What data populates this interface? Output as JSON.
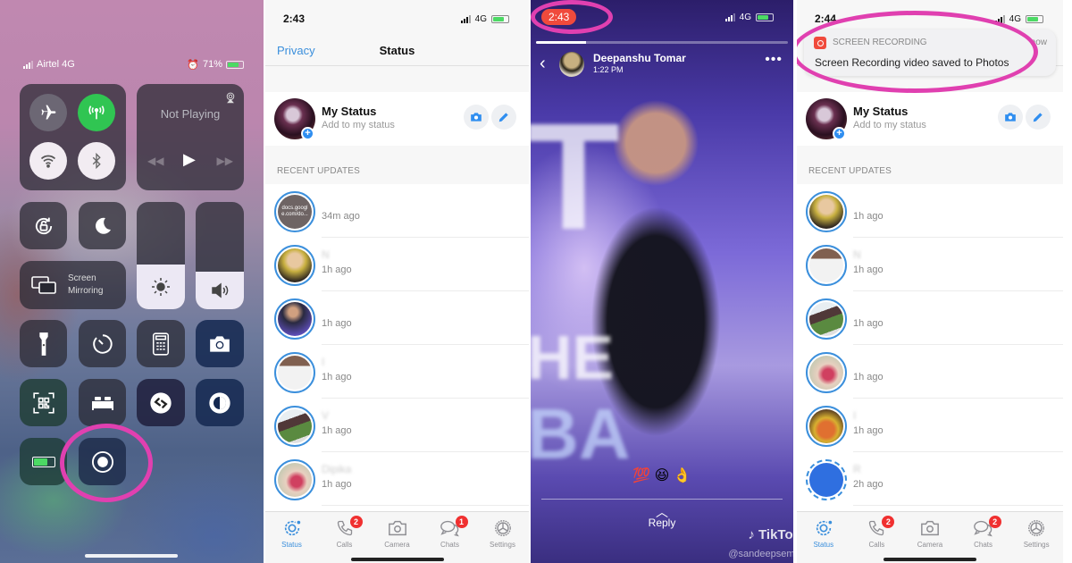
{
  "control_center": {
    "carrier": "Airtel 4G",
    "battery": "71%",
    "media": {
      "title": "Not Playing"
    },
    "screen_mirroring": {
      "line1": "Screen",
      "line2": "Mirroring"
    },
    "brightness_level": 0.42,
    "volume_level": 0.35,
    "colors": {
      "cellular_active": "#30c552",
      "highlight_ring": "#e040b0"
    }
  },
  "status_screen": {
    "time": "2:43",
    "network": "4G",
    "nav": {
      "left": "Privacy",
      "title": "Status"
    },
    "my_status": {
      "name": "My Status",
      "subtitle": "Add to my status"
    },
    "section_header": "RECENT UPDATES",
    "updates": [
      {
        "name": "",
        "thumb_text": "docs.googl e.com/do...",
        "time": "34m ago"
      },
      {
        "name": "N",
        "time": "1h ago"
      },
      {
        "name": "",
        "time": "1h ago"
      },
      {
        "name": "I",
        "time": "1h ago"
      },
      {
        "name": "V",
        "time": "1h ago"
      },
      {
        "name": "Dipika",
        "time": "1h ago"
      }
    ],
    "tabs": [
      {
        "label": "Status",
        "badge": ""
      },
      {
        "label": "Calls",
        "badge": "2"
      },
      {
        "label": "Camera",
        "badge": ""
      },
      {
        "label": "Chats",
        "badge": "1"
      },
      {
        "label": "Settings",
        "badge": ""
      }
    ],
    "accent": "#3b8fdc"
  },
  "status_viewer": {
    "recording_time": "2:43",
    "network": "4G",
    "progress": 0.2,
    "author": "Deepanshu Tomar",
    "posted": "1:22 PM",
    "caption": "💯 😆 👌",
    "reply_label": "Reply",
    "watermark": "TikTok",
    "watermark_user": "@sandeepsemi",
    "more_label": "•••",
    "back_label": "‹"
  },
  "status_screen_after": {
    "time": "2:44",
    "network": "4G",
    "notification": {
      "app": "SCREEN RECORDING",
      "when": "now",
      "message": "Screen Recording video saved to Photos"
    },
    "my_status": {
      "name": "My Status",
      "subtitle": "Add to my status"
    },
    "section_header": "RECENT UPDATES",
    "updates": [
      {
        "name": "",
        "time": "1h ago"
      },
      {
        "name": "N",
        "time": "1h ago"
      },
      {
        "name": "",
        "time": "1h ago"
      },
      {
        "name": "",
        "time": "1h ago"
      },
      {
        "name": "I",
        "time": "1h ago"
      },
      {
        "name": "R",
        "time": "2h ago"
      }
    ],
    "tabs": [
      {
        "label": "Status",
        "badge": ""
      },
      {
        "label": "Calls",
        "badge": "2"
      },
      {
        "label": "Camera",
        "badge": ""
      },
      {
        "label": "Chats",
        "badge": "2"
      },
      {
        "label": "Settings",
        "badge": ""
      }
    ]
  }
}
